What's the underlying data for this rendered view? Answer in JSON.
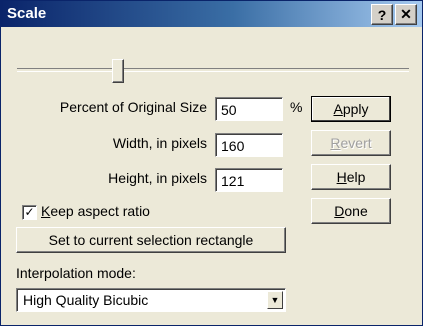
{
  "dialog": {
    "title": "Scale",
    "title_help": "?",
    "title_close": "✕",
    "percent_label": "Percent of Original Size",
    "percent_value": "50",
    "percent_unit": "%",
    "width_label": "Width, in pixels",
    "width_value": "160",
    "height_label": "Height, in pixels",
    "height_value": "121",
    "keep_aspect_label": "Keep aspect ratio",
    "keep_aspect_checked": true,
    "set_selection_label": "Set to current selection rectangle",
    "interp_label": "Interpolation mode:",
    "interp_value": "High Quality Bicubic",
    "slider_value_percent": 50
  },
  "buttons": {
    "apply": {
      "pre": "",
      "ul": "A",
      "post": "pply"
    },
    "revert": {
      "pre": "",
      "ul": "R",
      "post": "evert"
    },
    "help": {
      "pre": "",
      "ul": "H",
      "post": "elp"
    },
    "done": {
      "pre": "",
      "ul": "D",
      "post": "one"
    },
    "keep": {
      "ul": "K",
      "post": "eep aspect ratio"
    }
  },
  "colors": {
    "titlebar_start": "#0a246a",
    "titlebar_end": "#a6caf0",
    "face": "#ece9d8",
    "disabled_text": "#a0a0a0"
  },
  "icons": {
    "check": "✓",
    "dropdown": "▼"
  }
}
